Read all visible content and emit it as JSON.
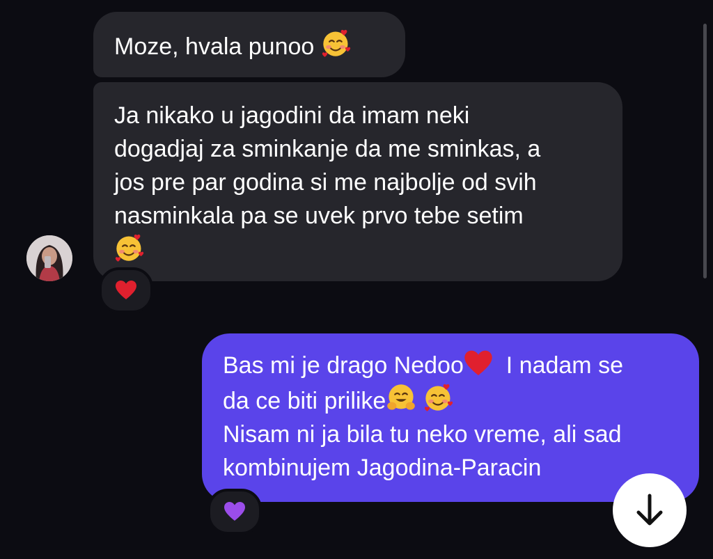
{
  "conversation": {
    "messages": [
      {
        "direction": "incoming",
        "text": "Moze, hvala punoo",
        "emoji": "smiling-face-with-hearts"
      },
      {
        "direction": "incoming",
        "lines": [
          "Ja nikako u jagodini da imam neki",
          "dogadjaj za sminkanje da me sminkas, a",
          "jos pre par godina si me najbolje od svih",
          "nasminkala pa se uvek prvo tebe setim"
        ],
        "emoji": "smiling-face-with-hearts",
        "reaction": "red-heart"
      },
      {
        "direction": "outgoing",
        "line_1_a": "Bas mi je drago Nedoo",
        "line_1_b": "I nadam se",
        "line_2": "da ce biti prilike",
        "line_3": "Nisam ni ja bila tu neko vreme, ali sad",
        "line_4": "kombinujem Jagodina-Paracin",
        "emojis": [
          "red-heart",
          "hugging-face",
          "smiling-face-with-hearts"
        ],
        "reaction": "purple-heart"
      }
    ]
  },
  "colors": {
    "background": "#0c0c12",
    "incoming_bubble": "#26262c",
    "outgoing_bubble": "#5a44ea",
    "text": "#ffffff",
    "red_heart": "#e0202e",
    "purple_heart": "#9b4dea"
  },
  "icons": {
    "scroll_down": "arrow-down-icon"
  }
}
